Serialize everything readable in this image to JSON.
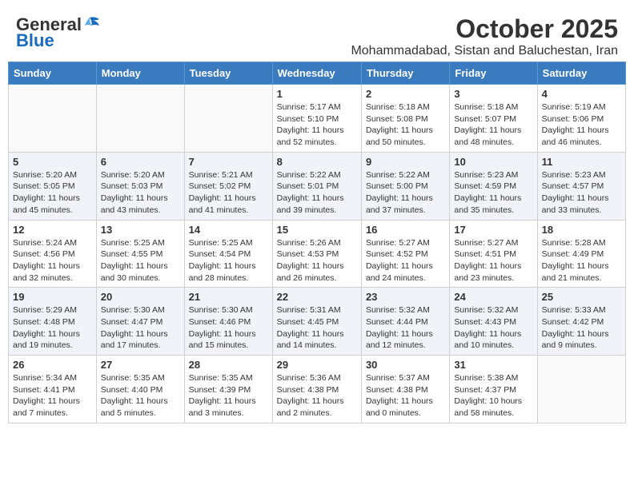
{
  "logo": {
    "general": "General",
    "blue": "Blue"
  },
  "header": {
    "month_title": "October 2025",
    "subtitle": "Mohammadabad, Sistan and Baluchestan, Iran"
  },
  "weekdays": [
    "Sunday",
    "Monday",
    "Tuesday",
    "Wednesday",
    "Thursday",
    "Friday",
    "Saturday"
  ],
  "weeks": [
    [
      {
        "day": "",
        "info": ""
      },
      {
        "day": "",
        "info": ""
      },
      {
        "day": "",
        "info": ""
      },
      {
        "day": "1",
        "info": "Sunrise: 5:17 AM\nSunset: 5:10 PM\nDaylight: 11 hours\nand 52 minutes."
      },
      {
        "day": "2",
        "info": "Sunrise: 5:18 AM\nSunset: 5:08 PM\nDaylight: 11 hours\nand 50 minutes."
      },
      {
        "day": "3",
        "info": "Sunrise: 5:18 AM\nSunset: 5:07 PM\nDaylight: 11 hours\nand 48 minutes."
      },
      {
        "day": "4",
        "info": "Sunrise: 5:19 AM\nSunset: 5:06 PM\nDaylight: 11 hours\nand 46 minutes."
      }
    ],
    [
      {
        "day": "5",
        "info": "Sunrise: 5:20 AM\nSunset: 5:05 PM\nDaylight: 11 hours\nand 45 minutes."
      },
      {
        "day": "6",
        "info": "Sunrise: 5:20 AM\nSunset: 5:03 PM\nDaylight: 11 hours\nand 43 minutes."
      },
      {
        "day": "7",
        "info": "Sunrise: 5:21 AM\nSunset: 5:02 PM\nDaylight: 11 hours\nand 41 minutes."
      },
      {
        "day": "8",
        "info": "Sunrise: 5:22 AM\nSunset: 5:01 PM\nDaylight: 11 hours\nand 39 minutes."
      },
      {
        "day": "9",
        "info": "Sunrise: 5:22 AM\nSunset: 5:00 PM\nDaylight: 11 hours\nand 37 minutes."
      },
      {
        "day": "10",
        "info": "Sunrise: 5:23 AM\nSunset: 4:59 PM\nDaylight: 11 hours\nand 35 minutes."
      },
      {
        "day": "11",
        "info": "Sunrise: 5:23 AM\nSunset: 4:57 PM\nDaylight: 11 hours\nand 33 minutes."
      }
    ],
    [
      {
        "day": "12",
        "info": "Sunrise: 5:24 AM\nSunset: 4:56 PM\nDaylight: 11 hours\nand 32 minutes."
      },
      {
        "day": "13",
        "info": "Sunrise: 5:25 AM\nSunset: 4:55 PM\nDaylight: 11 hours\nand 30 minutes."
      },
      {
        "day": "14",
        "info": "Sunrise: 5:25 AM\nSunset: 4:54 PM\nDaylight: 11 hours\nand 28 minutes."
      },
      {
        "day": "15",
        "info": "Sunrise: 5:26 AM\nSunset: 4:53 PM\nDaylight: 11 hours\nand 26 minutes."
      },
      {
        "day": "16",
        "info": "Sunrise: 5:27 AM\nSunset: 4:52 PM\nDaylight: 11 hours\nand 24 minutes."
      },
      {
        "day": "17",
        "info": "Sunrise: 5:27 AM\nSunset: 4:51 PM\nDaylight: 11 hours\nand 23 minutes."
      },
      {
        "day": "18",
        "info": "Sunrise: 5:28 AM\nSunset: 4:49 PM\nDaylight: 11 hours\nand 21 minutes."
      }
    ],
    [
      {
        "day": "19",
        "info": "Sunrise: 5:29 AM\nSunset: 4:48 PM\nDaylight: 11 hours\nand 19 minutes."
      },
      {
        "day": "20",
        "info": "Sunrise: 5:30 AM\nSunset: 4:47 PM\nDaylight: 11 hours\nand 17 minutes."
      },
      {
        "day": "21",
        "info": "Sunrise: 5:30 AM\nSunset: 4:46 PM\nDaylight: 11 hours\nand 15 minutes."
      },
      {
        "day": "22",
        "info": "Sunrise: 5:31 AM\nSunset: 4:45 PM\nDaylight: 11 hours\nand 14 minutes."
      },
      {
        "day": "23",
        "info": "Sunrise: 5:32 AM\nSunset: 4:44 PM\nDaylight: 11 hours\nand 12 minutes."
      },
      {
        "day": "24",
        "info": "Sunrise: 5:32 AM\nSunset: 4:43 PM\nDaylight: 11 hours\nand 10 minutes."
      },
      {
        "day": "25",
        "info": "Sunrise: 5:33 AM\nSunset: 4:42 PM\nDaylight: 11 hours\nand 9 minutes."
      }
    ],
    [
      {
        "day": "26",
        "info": "Sunrise: 5:34 AM\nSunset: 4:41 PM\nDaylight: 11 hours\nand 7 minutes."
      },
      {
        "day": "27",
        "info": "Sunrise: 5:35 AM\nSunset: 4:40 PM\nDaylight: 11 hours\nand 5 minutes."
      },
      {
        "day": "28",
        "info": "Sunrise: 5:35 AM\nSunset: 4:39 PM\nDaylight: 11 hours\nand 3 minutes."
      },
      {
        "day": "29",
        "info": "Sunrise: 5:36 AM\nSunset: 4:38 PM\nDaylight: 11 hours\nand 2 minutes."
      },
      {
        "day": "30",
        "info": "Sunrise: 5:37 AM\nSunset: 4:38 PM\nDaylight: 11 hours\nand 0 minutes."
      },
      {
        "day": "31",
        "info": "Sunrise: 5:38 AM\nSunset: 4:37 PM\nDaylight: 10 hours\nand 58 minutes."
      },
      {
        "day": "",
        "info": ""
      }
    ]
  ]
}
